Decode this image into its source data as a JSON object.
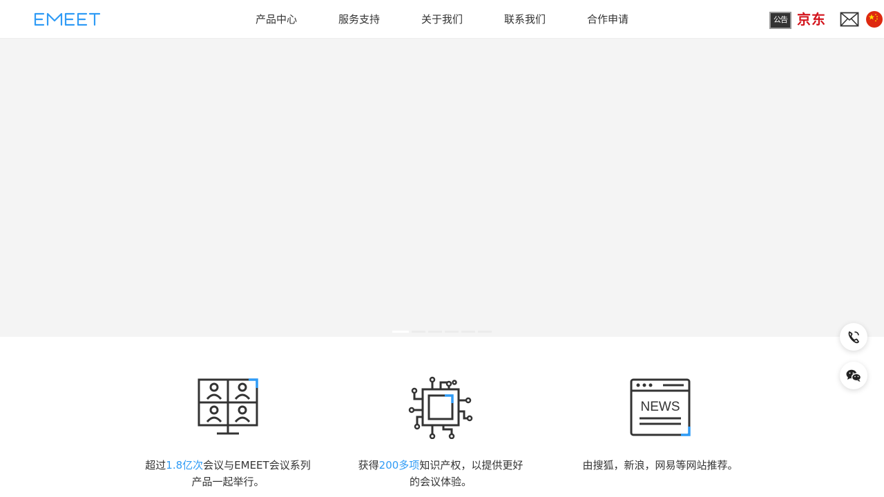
{
  "header": {
    "logo_text": "EMEET",
    "nav": [
      "产品中心",
      "服务支持",
      "关于我们",
      "联系我们",
      "合作申请"
    ],
    "notice_label": "公告",
    "jd_label": "京东"
  },
  "banner": {
    "slide_count": 6,
    "active_slide": 1
  },
  "features": [
    {
      "prefix": "超过",
      "highlight": "1.8亿次",
      "suffix": "会议与EMEET会议系列产品一起举行。"
    },
    {
      "prefix": "获得",
      "highlight": "200多项",
      "suffix": "知识产权，以提供更好的会议体验。"
    },
    {
      "prefix": "由搜狐，新浪，网易等网站推荐。",
      "highlight": "",
      "suffix": ""
    }
  ],
  "colors": {
    "accent": "#2f9bf5",
    "jd_red": "#d3141c",
    "banner_bg": "#f4f4f4"
  },
  "icons": [
    "envelope-icon",
    "china-flag-icon",
    "phone-icon",
    "wechat-icon",
    "video-meeting-icon",
    "chip-icon",
    "news-icon"
  ]
}
